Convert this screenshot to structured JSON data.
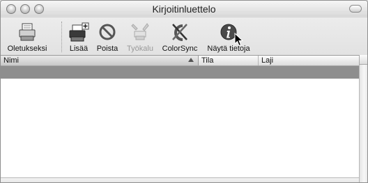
{
  "window": {
    "title": "Kirjoitinluettelo"
  },
  "toolbar": {
    "items": [
      {
        "label": "Oletukseksi",
        "icon": "printer-default-icon",
        "enabled": true
      },
      {
        "label": "Lisää",
        "icon": "add-printer-icon",
        "enabled": true
      },
      {
        "label": "Poista",
        "icon": "delete-icon",
        "enabled": true
      },
      {
        "label": "Työkalu",
        "icon": "utility-tools-icon",
        "enabled": false
      },
      {
        "label": "ColorSync",
        "icon": "colorsync-icon",
        "enabled": true
      },
      {
        "label": "Näytä tietoja",
        "icon": "info-icon",
        "enabled": true
      }
    ]
  },
  "table": {
    "columns": [
      "Nimi",
      "Tila",
      "Laji"
    ],
    "sort_column": "Nimi",
    "rows": [
      {
        "selected": true,
        "cells": [
          "",
          "",
          ""
        ]
      }
    ]
  },
  "colors": {
    "selection": "#8e8e8e",
    "window_bg": "#ececec"
  }
}
